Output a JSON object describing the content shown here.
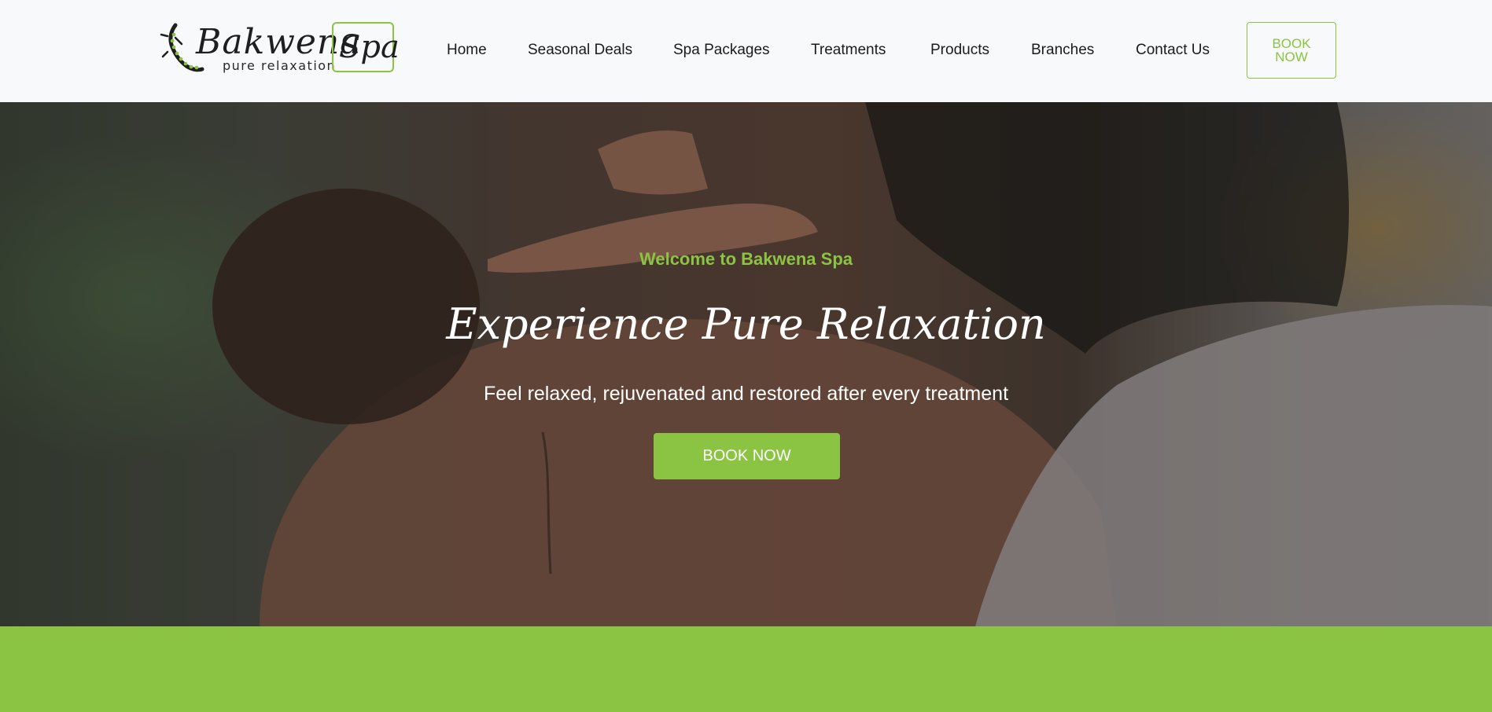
{
  "header": {
    "logo": {
      "wordmark": "Bakwena",
      "box_text": "Spa",
      "tagline": "pure relaxation"
    },
    "nav": [
      {
        "label": "Home"
      },
      {
        "label": "Seasonal Deals"
      },
      {
        "label": "Spa Packages"
      },
      {
        "label": "Treatments"
      },
      {
        "label": "Products"
      },
      {
        "label": "Branches"
      },
      {
        "label": "Contact Us"
      }
    ],
    "book_button": "BOOK NOW"
  },
  "hero": {
    "welcome": "Welcome to Bakwena Spa",
    "title": "Experience Pure Relaxation",
    "subtitle": "Feel relaxed, rejuvenated and restored after every treatment",
    "cta": "BOOK NOW"
  },
  "colors": {
    "accent": "#8bc442",
    "header_bg": "#f8f9fb",
    "text_dark": "#1b1b1b",
    "hero_text": "#ffffff"
  }
}
